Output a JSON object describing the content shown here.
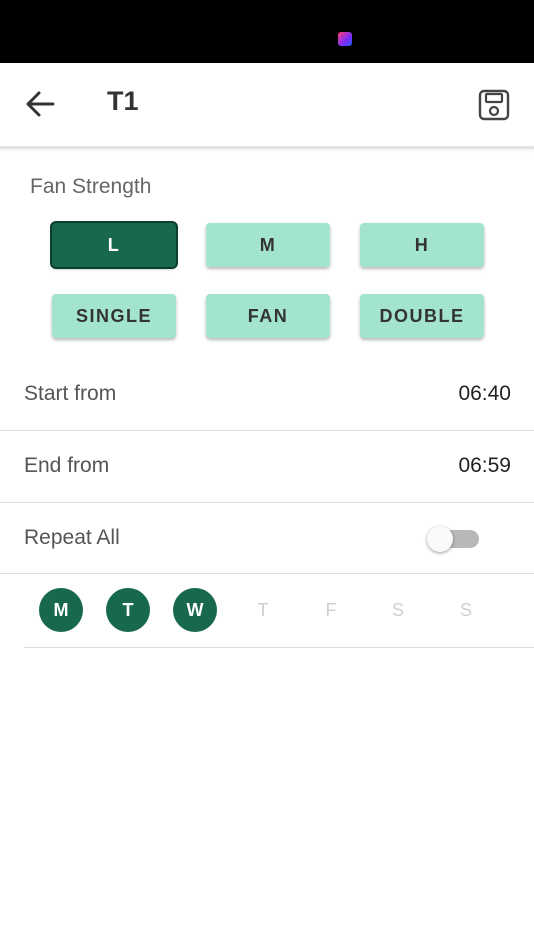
{
  "header": {
    "title": "T1",
    "back_icon": "arrow-left-icon",
    "save_icon": "save-icon"
  },
  "fan_strength": {
    "label": "Fan Strength",
    "levels": [
      "L",
      "M",
      "H"
    ],
    "selected_level": "L",
    "modes": [
      "SINGLE",
      "FAN",
      "DOUBLE"
    ]
  },
  "schedule": {
    "start_label": "Start from",
    "start_time": "06:40",
    "end_label": "End from",
    "end_time": "06:59"
  },
  "repeat": {
    "label": "Repeat All",
    "enabled": false
  },
  "days": [
    {
      "label": "M",
      "selected": true
    },
    {
      "label": "T",
      "selected": true
    },
    {
      "label": "W",
      "selected": true
    },
    {
      "label": "T",
      "selected": false
    },
    {
      "label": "F",
      "selected": false
    },
    {
      "label": "S",
      "selected": false
    },
    {
      "label": "S",
      "selected": false
    }
  ],
  "colors": {
    "accent_dark": "#17684c",
    "accent_light": "#a3e4cc",
    "toggle_off": "#b8b8b8"
  }
}
